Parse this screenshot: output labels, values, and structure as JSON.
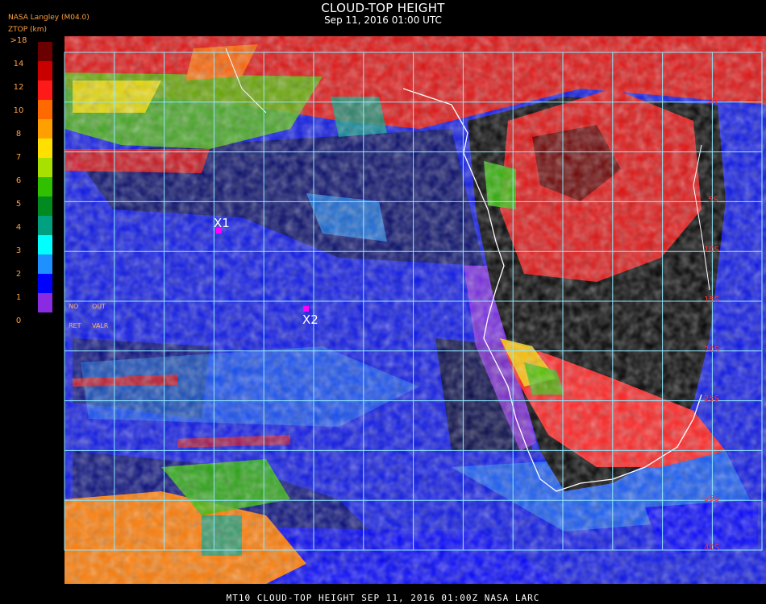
{
  "title": "CLOUD-TOP HEIGHT",
  "subtitle": "Sep 11, 2016 01:00 UTC",
  "provider": "NASA Langley (M04.0)",
  "legend_title": "ZTOP (km)",
  "legend": {
    "ticks": [
      ">18",
      "14",
      "12",
      "10",
      "8",
      "7",
      "6",
      "5",
      "4",
      "3",
      "2",
      "1",
      "0"
    ],
    "colors": [
      "#6b0000",
      "#c80000",
      "#ff1a1a",
      "#ff6a00",
      "#ffa000",
      "#ffe000",
      "#a8e000",
      "#30c000",
      "#008a20",
      "#00a080",
      "#00ffff",
      "#1e90ff",
      "#0000ff",
      "#8a2be2"
    ],
    "no_ret": [
      "NO",
      "RET"
    ],
    "out_valr": [
      "OUT",
      "VALR"
    ]
  },
  "markers": [
    {
      "label": "X1",
      "color": "#ff00ff"
    },
    {
      "label": "X2",
      "color": "#ff00ff"
    }
  ],
  "latitude_labels": [
    "5N",
    "5S",
    "10S",
    "15S",
    "20S",
    "25S",
    "35S",
    "40S"
  ],
  "footer": "MT10  CLOUD-TOP HEIGHT   SEP 11, 2016 01:00Z   NASA LARC"
}
